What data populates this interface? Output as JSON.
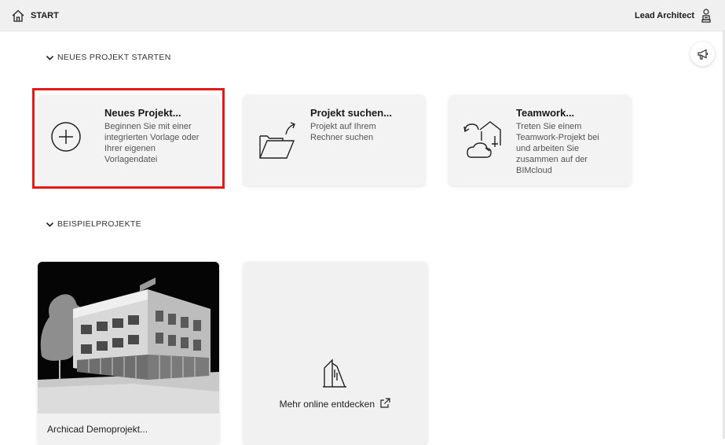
{
  "header": {
    "title": "START",
    "user_name": "Lead Architect",
    "home_icon": "home-icon",
    "user_icon": "user-icon"
  },
  "sections": {
    "new_project_label": "NEUES PROJEKT STARTEN",
    "examples_label": "BEISPIELPROJEKTE"
  },
  "cards": [
    {
      "title": "Neues Projekt...",
      "desc": [
        "Beginnen Sie mit einer",
        "integrierten Vorlage oder",
        "Ihrer eigenen",
        "Vorlagendatei"
      ],
      "icon": "plus-circle-icon"
    },
    {
      "title": "Projekt suchen...",
      "desc": [
        "Projekt auf Ihrem",
        "Rechner suchen"
      ],
      "icon": "open-folder-icon"
    },
    {
      "title": "Teamwork...",
      "desc": [
        "Treten Sie einem",
        "Teamwork-Projekt bei",
        "und arbeiten Sie",
        "zusammen auf der",
        "BIMcloud"
      ],
      "icon": "teamwork-cloud-icon"
    }
  ],
  "examples": {
    "demo_label": "Archicad Demoprojekt...",
    "more_label": "Mehr online entdecken",
    "more_icon": "external-link-icon"
  },
  "announce_icon": "megaphone-icon",
  "colors": {
    "header_bg": "#f0f0f0",
    "card_bg": "#f3f3f3",
    "highlight": "#e31a1a"
  }
}
